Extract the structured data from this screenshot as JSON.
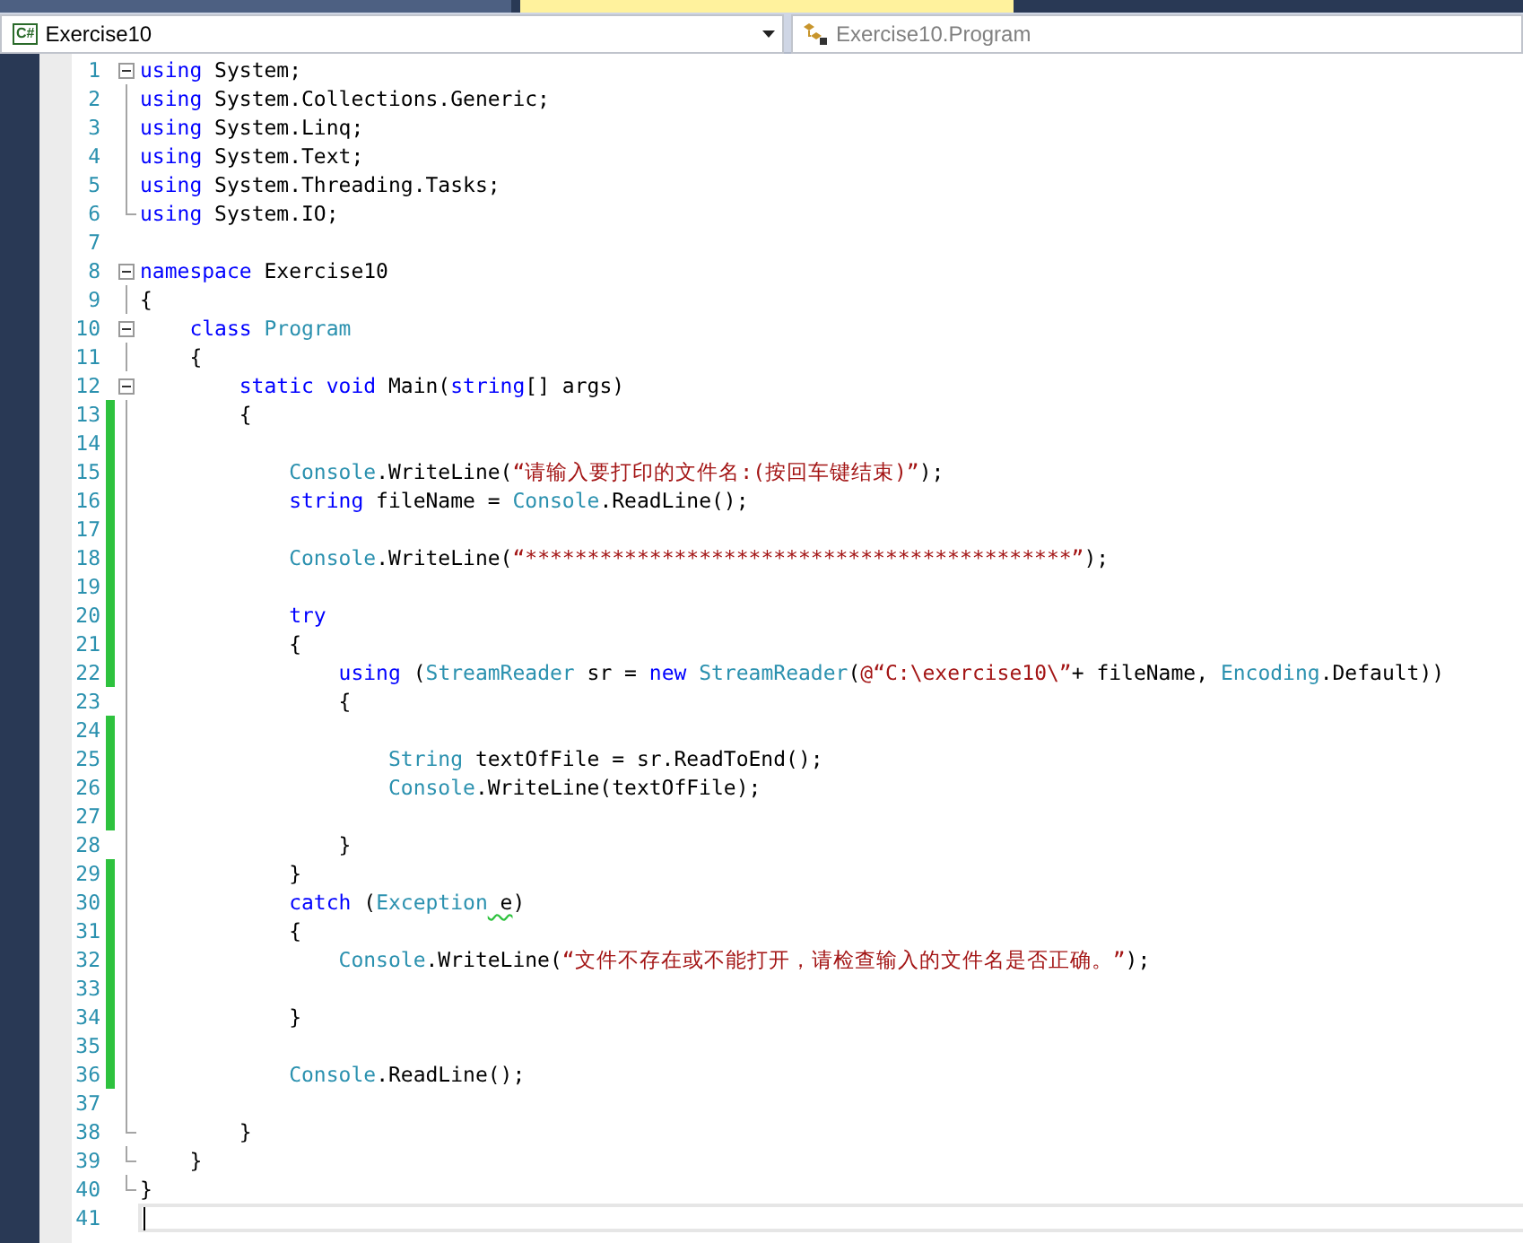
{
  "tabs": [
    {
      "selected": false
    },
    {
      "selected": true
    }
  ],
  "nav_bar": {
    "project": {
      "icon": "C#",
      "label": "Exercise10"
    },
    "member": {
      "label": "Exercise10.Program",
      "disabled": true
    }
  },
  "lines": [
    {
      "number": "1",
      "changed": false,
      "kind": "fold_start",
      "current": false,
      "tokens": [
        {
          "kind": "kw",
          "text": "using"
        },
        {
          "kind": "plain",
          "text": " System;"
        }
      ]
    },
    {
      "number": "2",
      "changed": false,
      "kind": "fold_body",
      "current": false,
      "tokens": [
        {
          "kind": "kw",
          "text": "using"
        },
        {
          "kind": "plain",
          "text": " System.Collections.Generic;"
        }
      ]
    },
    {
      "number": "3",
      "changed": false,
      "kind": "fold_body",
      "current": false,
      "tokens": [
        {
          "kind": "kw",
          "text": "using"
        },
        {
          "kind": "plain",
          "text": " System.Linq;"
        }
      ]
    },
    {
      "number": "4",
      "changed": false,
      "kind": "fold_body",
      "current": false,
      "tokens": [
        {
          "kind": "kw",
          "text": "using"
        },
        {
          "kind": "plain",
          "text": " System.Text;"
        }
      ]
    },
    {
      "number": "5",
      "changed": false,
      "kind": "fold_body",
      "current": false,
      "tokens": [
        {
          "kind": "kw",
          "text": "using"
        },
        {
          "kind": "plain",
          "text": " System.Threading.Tasks;"
        }
      ]
    },
    {
      "number": "6",
      "changed": false,
      "kind": "fold_end",
      "current": false,
      "tokens": [
        {
          "kind": "kw",
          "text": "using"
        },
        {
          "kind": "plain",
          "text": " System.IO;"
        }
      ]
    },
    {
      "number": "7",
      "changed": false,
      "kind": "plain",
      "current": false
    },
    {
      "number": "8",
      "changed": false,
      "kind": "fold_start",
      "current": false,
      "tokens": [
        {
          "kind": "kw",
          "text": "namespace"
        },
        {
          "kind": "plain",
          "text": " Exercise10"
        }
      ]
    },
    {
      "number": "9",
      "changed": false,
      "kind": "fold_body",
      "current": false,
      "tokens": [
        {
          "kind": "plain",
          "text": "{"
        }
      ]
    },
    {
      "number": "10",
      "changed": false,
      "kind": "fold_start",
      "current": false,
      "tokens": [
        {
          "kind": "kw",
          "text": "    class"
        },
        {
          "kind": "type",
          "text": " Program"
        }
      ]
    },
    {
      "number": "11",
      "changed": false,
      "kind": "fold_body",
      "current": false,
      "tokens": [
        {
          "kind": "plain",
          "text": "    {"
        }
      ]
    },
    {
      "number": "12",
      "changed": false,
      "kind": "fold_start",
      "current": false,
      "tokens": [
        {
          "kind": "kw",
          "text": "        static void"
        },
        {
          "kind": "plain",
          "text": " Main("
        },
        {
          "kind": "kw",
          "text": "string"
        },
        {
          "kind": "plain",
          "text": "[] args)"
        }
      ]
    },
    {
      "number": "13",
      "changed": true,
      "kind": "fold_body",
      "current": false,
      "tokens": [
        {
          "kind": "plain",
          "text": "        {"
        }
      ]
    },
    {
      "number": "14",
      "changed": true,
      "kind": "fold_body",
      "current": false
    },
    {
      "number": "15",
      "changed": true,
      "kind": "fold_body",
      "current": false,
      "tokens": [
        {
          "kind": "type",
          "text": "            Console"
        },
        {
          "kind": "plain",
          "text": ".WriteLine("
        },
        {
          "kind": "str",
          "text": "“请输入要打印的文件名:(按回车键结束)”"
        },
        {
          "kind": "plain",
          "text": ");"
        }
      ]
    },
    {
      "number": "16",
      "changed": true,
      "kind": "fold_body",
      "current": false,
      "tokens": [
        {
          "kind": "kw",
          "text": "            string"
        },
        {
          "kind": "plain",
          "text": " fileName = "
        },
        {
          "kind": "type",
          "text": "Console"
        },
        {
          "kind": "plain",
          "text": ".ReadLine();"
        }
      ]
    },
    {
      "number": "17",
      "changed": true,
      "kind": "fold_body",
      "current": false
    },
    {
      "number": "18",
      "changed": true,
      "kind": "fold_body",
      "current": false,
      "tokens": [
        {
          "kind": "type",
          "text": "            Console"
        },
        {
          "kind": "plain",
          "text": ".WriteLine("
        },
        {
          "kind": "str",
          "text": "“********************************************”"
        },
        {
          "kind": "plain",
          "text": ");"
        }
      ]
    },
    {
      "number": "19",
      "changed": true,
      "kind": "fold_body",
      "current": false
    },
    {
      "number": "20",
      "changed": true,
      "kind": "fold_body",
      "current": false,
      "tokens": [
        {
          "kind": "kw",
          "text": "            try"
        }
      ]
    },
    {
      "number": "21",
      "changed": true,
      "kind": "fold_body",
      "current": false,
      "tokens": [
        {
          "kind": "plain",
          "text": "            {"
        }
      ]
    },
    {
      "number": "22",
      "changed": true,
      "kind": "fold_body",
      "current": false,
      "tokens": [
        {
          "kind": "kw",
          "text": "                using"
        },
        {
          "kind": "plain",
          "text": " ("
        },
        {
          "kind": "type",
          "text": "StreamReader"
        },
        {
          "kind": "plain",
          "text": " sr = "
        },
        {
          "kind": "kw",
          "text": "new"
        },
        {
          "kind": "type",
          "text": " StreamReader"
        },
        {
          "kind": "plain",
          "text": "("
        },
        {
          "kind": "str",
          "text": "@“C:\\exercise10\\”"
        },
        {
          "kind": "plain",
          "text": "+ fileName, "
        },
        {
          "kind": "type",
          "text": "Encoding"
        },
        {
          "kind": "plain",
          "text": ".Default))"
        }
      ]
    },
    {
      "number": "23",
      "changed": false,
      "kind": "fold_body",
      "current": false,
      "tokens": [
        {
          "kind": "plain",
          "text": "                {"
        }
      ]
    },
    {
      "number": "24",
      "changed": true,
      "kind": "fold_body",
      "current": false
    },
    {
      "number": "25",
      "changed": true,
      "kind": "fold_body",
      "current": false,
      "tokens": [
        {
          "kind": "type",
          "text": "                    String"
        },
        {
          "kind": "plain",
          "text": " textOfFile = sr.ReadToEnd();"
        }
      ]
    },
    {
      "number": "26",
      "changed": true,
      "kind": "fold_body",
      "current": false,
      "tokens": [
        {
          "kind": "type",
          "text": "                    Console"
        },
        {
          "kind": "plain",
          "text": ".WriteLine(textOfFile);"
        }
      ]
    },
    {
      "number": "27",
      "changed": true,
      "kind": "fold_body",
      "current": false
    },
    {
      "number": "28",
      "changed": false,
      "kind": "fold_body",
      "current": false,
      "tokens": [
        {
          "kind": "plain",
          "text": "                }"
        }
      ]
    },
    {
      "number": "29",
      "changed": true,
      "kind": "fold_body",
      "current": false,
      "tokens": [
        {
          "kind": "plain",
          "text": "            }"
        }
      ]
    },
    {
      "number": "30",
      "changed": true,
      "kind": "fold_body",
      "current": false,
      "tokens": [
        {
          "kind": "kw",
          "text": "            catch"
        },
        {
          "kind": "plain",
          "text": " ("
        },
        {
          "kind": "type",
          "text": "Exception"
        },
        {
          "kind": "plain",
          "text": " e",
          "warning": true
        },
        {
          "kind": "plain",
          "text": ")"
        }
      ]
    },
    {
      "number": "31",
      "changed": true,
      "kind": "fold_body",
      "current": false,
      "tokens": [
        {
          "kind": "plain",
          "text": "            {"
        }
      ]
    },
    {
      "number": "32",
      "changed": true,
      "kind": "fold_body",
      "current": false,
      "tokens": [
        {
          "kind": "type",
          "text": "                Console"
        },
        {
          "kind": "plain",
          "text": ".WriteLine("
        },
        {
          "kind": "str",
          "text": "“文件不存在或不能打开，请检查输入的文件名是否正确。”"
        },
        {
          "kind": "plain",
          "text": ");"
        }
      ]
    },
    {
      "number": "33",
      "changed": true,
      "kind": "fold_body",
      "current": false
    },
    {
      "number": "34",
      "changed": true,
      "kind": "fold_body",
      "current": false,
      "tokens": [
        {
          "kind": "plain",
          "text": "            }"
        }
      ]
    },
    {
      "number": "35",
      "changed": true,
      "kind": "fold_body",
      "current": false
    },
    {
      "number": "36",
      "changed": true,
      "kind": "fold_body",
      "current": false,
      "tokens": [
        {
          "kind": "type",
          "text": "            Console"
        },
        {
          "kind": "plain",
          "text": ".ReadLine();"
        }
      ]
    },
    {
      "number": "37",
      "changed": false,
      "kind": "fold_body",
      "current": false
    },
    {
      "number": "38",
      "changed": false,
      "kind": "fold_end",
      "current": false,
      "tokens": [
        {
          "kind": "plain",
          "text": "        }"
        }
      ]
    },
    {
      "number": "39",
      "changed": false,
      "kind": "fold_end",
      "current": false,
      "tokens": [
        {
          "kind": "plain",
          "text": "    }"
        }
      ]
    },
    {
      "number": "40",
      "changed": false,
      "kind": "fold_end",
      "current": false,
      "tokens": [
        {
          "kind": "plain",
          "text": "}"
        }
      ]
    },
    {
      "number": "41",
      "changed": false,
      "kind": "plain",
      "current": true
    }
  ]
}
